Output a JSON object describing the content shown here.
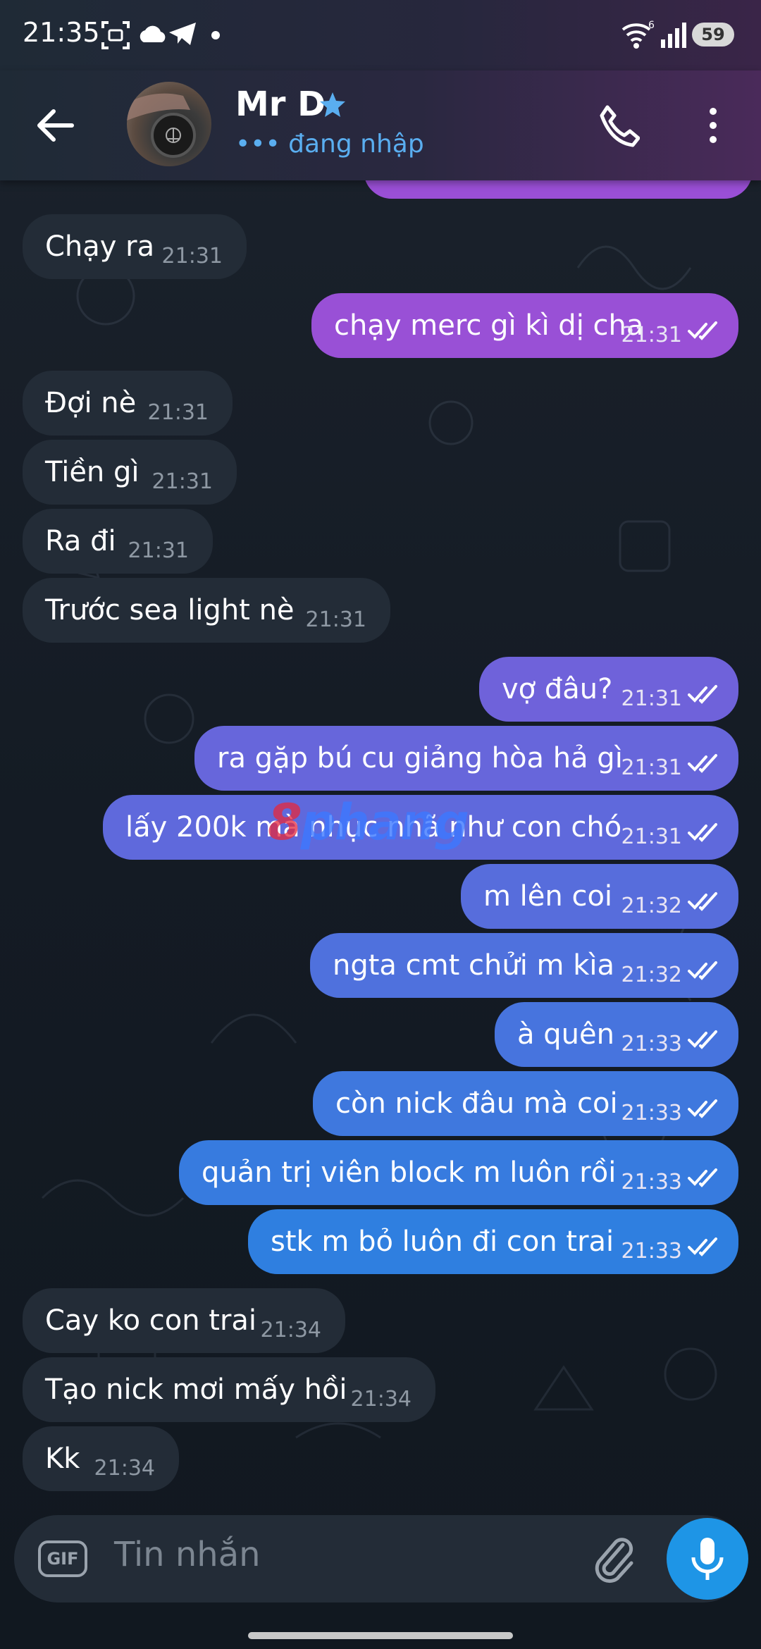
{
  "status_bar": {
    "time": "21:35",
    "battery": "59",
    "icons": [
      "screenshot-icon",
      "cloud-icon",
      "telegram-icon",
      "dot-icon",
      "wifi-icon",
      "signal-icon",
      "battery-icon"
    ]
  },
  "header": {
    "contact_name": "Mr D",
    "status_text": "••• đang nhập",
    "icons": [
      "back-arrow-icon",
      "avatar",
      "star-icon",
      "phone-icon",
      "more-vertical-icon"
    ]
  },
  "watermark": {
    "part1": "8",
    "part2": "phang"
  },
  "messages": [
    {
      "dir": "in",
      "text": "Chạy ra",
      "time": "21:31"
    },
    {
      "dir": "out",
      "text": "chạy merc gì kì dị cha",
      "time": "21:31"
    },
    {
      "dir": "in",
      "text": "Đợi nè",
      "time": "21:31"
    },
    {
      "dir": "in",
      "text": "Tiền gì",
      "time": "21:31"
    },
    {
      "dir": "in",
      "text": "Ra đi",
      "time": "21:31"
    },
    {
      "dir": "in",
      "text": "Trước sea light nè",
      "time": "21:31"
    },
    {
      "dir": "out",
      "text": "vợ đâu?",
      "time": "21:31"
    },
    {
      "dir": "out",
      "text": "ra gặp bú cu giảng hòa hả gì",
      "time": "21:31"
    },
    {
      "dir": "out",
      "text": "lấy 200k mà nhục nhã như con chó",
      "time": "21:31"
    },
    {
      "dir": "out",
      "text": "m lên coi",
      "time": "21:32"
    },
    {
      "dir": "out",
      "text": "ngta cmt chửi m kìa",
      "time": "21:32"
    },
    {
      "dir": "out",
      "text": "à quên",
      "time": "21:33"
    },
    {
      "dir": "out",
      "text": "còn nick đâu mà coi",
      "time": "21:33"
    },
    {
      "dir": "out",
      "text": "quản trị viên block m luôn rồi",
      "time": "21:33"
    },
    {
      "dir": "out",
      "text": "stk m bỏ luôn đi con trai",
      "time": "21:33"
    },
    {
      "dir": "in",
      "text": "Cay ko con trai",
      "time": "21:34"
    },
    {
      "dir": "in",
      "text": "Tạo nick mơi mấy hồi",
      "time": "21:34"
    },
    {
      "dir": "in",
      "text": "Kk",
      "time": "21:34"
    }
  ],
  "composer": {
    "gif_label": "GIF",
    "placeholder": "Tin nhắn",
    "icons": [
      "gif-icon",
      "attach-icon",
      "microphone-icon"
    ]
  },
  "colors": {
    "incoming_bubble": "#232c37",
    "outgoing_top": "#9a4fd6",
    "outgoing_bottom": "#2f7fe0",
    "accent": "#1e95e6"
  }
}
